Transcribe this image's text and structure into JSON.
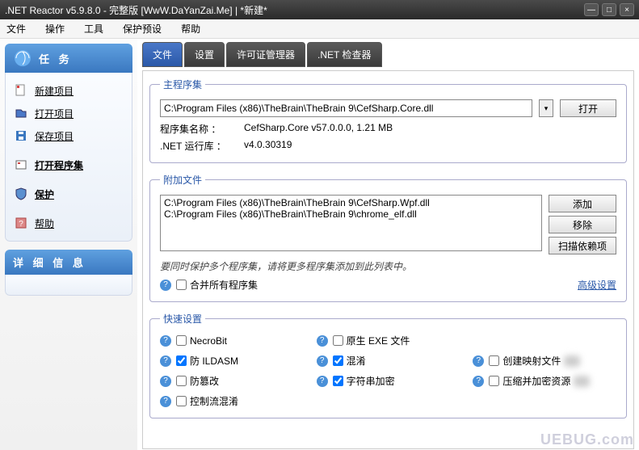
{
  "window": {
    "title": ".NET Reactor v5.9.8.0 - 完整版 [WwW.DaYanZai.Me]  | *新建*"
  },
  "menu": {
    "file": "文件",
    "ops": "操作",
    "tools": "工具",
    "protect": "保护预设",
    "help": "帮助"
  },
  "sidebar": {
    "tasks_header": "任  务",
    "detail_header": "详  细  信  息",
    "items": {
      "new": "新建项目",
      "open": "打开项目",
      "save": "保存项目",
      "open_asm": "打开程序集",
      "protect": "保护",
      "help": "帮助"
    }
  },
  "tabs": {
    "file": "文件",
    "settings": "设置",
    "license": "许可证管理器",
    "inspector": ".NET 检查器"
  },
  "main_asm": {
    "legend": "主程序集",
    "path": "C:\\Program Files (x86)\\TheBrain\\TheBrain 9\\CefSharp.Core.dll",
    "open_btn": "打开",
    "name_label": "程序集名称 ：",
    "name_value": "CefSharp.Core  v57.0.0.0,  1.21 MB",
    "runtime_label": ".NET 运行库 ：",
    "runtime_value": "v4.0.30319"
  },
  "extra": {
    "legend": "附加文件",
    "files": "C:\\Program Files (x86)\\TheBrain\\TheBrain 9\\CefSharp.Wpf.dll\nC:\\Program Files (x86)\\TheBrain\\TheBrain 9\\chrome_elf.dll",
    "add_btn": "添加",
    "remove_btn": "移除",
    "scan_btn": "扫描依赖项",
    "hint": "要同时保护多个程序集，请将更多程序集添加到此列表中。",
    "merge_label": "合并所有程序集",
    "advanced_link": "高级设置"
  },
  "quick": {
    "legend": "快速设置",
    "necrobit": "NecroBit",
    "native": "原生 EXE 文件",
    "anti_ildasm": "防 ILDASM",
    "obfuscate": "混淆",
    "mapping": "创建映射文件",
    "anti_tamper": "防篡改",
    "string_enc": "字符串加密",
    "compress": "压缩并加密资源",
    "control_flow": "控制流混淆"
  },
  "watermark": "UEBUG.com"
}
